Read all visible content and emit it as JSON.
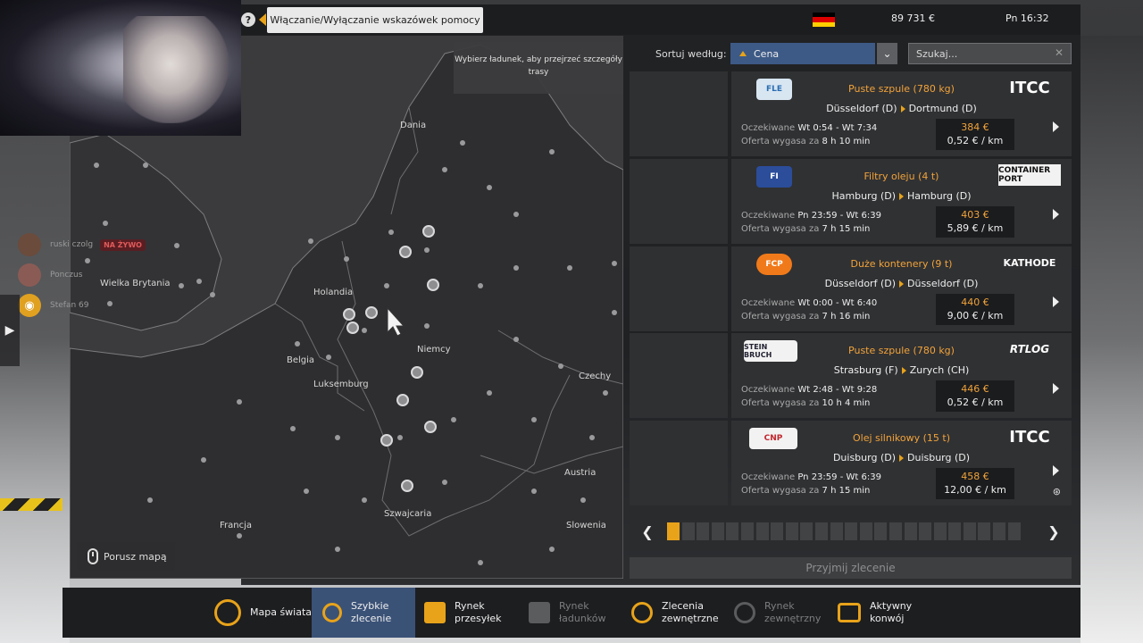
{
  "topbar": {
    "help_icon": "question-icon",
    "tooltip": "Włączanie/Wyłączanie wskazówek pomocy",
    "money": "89 731 €",
    "clock": "Pn 16:32"
  },
  "chat": [
    {
      "name": "ruski czolg",
      "badge": "NA ŻYWO"
    },
    {
      "name": "Ponczus",
      "badge": ""
    },
    {
      "name": "Stefan 69",
      "badge": ""
    }
  ],
  "map": {
    "info": "Wybierz ładunek, aby przejrzeć szczegóły trasy",
    "hint": "Porusz mapą",
    "labels": {
      "dania": "Dania",
      "wielka_brytania": "Wielka Brytania",
      "holandia": "Holandia",
      "niemcy": "Niemcy",
      "belgia": "Belgia",
      "luksemburg": "Luksemburg",
      "czechy": "Czechy",
      "austria": "Austria",
      "francja": "Francja",
      "szwajcaria": "Szwajcaria",
      "slowenia": "Slowenia"
    }
  },
  "sort": {
    "label": "Sortuj według:",
    "selected": "Cena",
    "search_placeholder": "Szukaj..."
  },
  "jobs": [
    {
      "logo": "FLE",
      "company": "ITCC",
      "cargo": "Puste szpule (780 kg)",
      "from": "Düsseldorf (D)",
      "to": "Dortmund (D)",
      "exp_label": "Oczekiwane",
      "expected": "Wt 0:54 - Wt 7:34",
      "off_label": "Oferta wygasa za",
      "expires": "8 h 10 min",
      "price": "384 €",
      "rate": "0,52 € / km"
    },
    {
      "logo": "FI",
      "company": "CONTAINER PORT",
      "cargo": "Filtry oleju (4 t)",
      "from": "Hamburg (D)",
      "to": "Hamburg (D)",
      "exp_label": "Oczekiwane",
      "expected": "Pn 23:59 - Wt 6:39",
      "off_label": "Oferta wygasa za",
      "expires": "7 h 15 min",
      "price": "403 €",
      "rate": "5,89 € / km"
    },
    {
      "logo": "FCP",
      "company": "KATHODE",
      "cargo": "Duże kontenery (9 t)",
      "from": "Düsseldorf (D)",
      "to": "Düsseldorf (D)",
      "exp_label": "Oczekiwane",
      "expected": "Wt 0:00 - Wt 6:40",
      "off_label": "Oferta wygasa za",
      "expires": "7 h 16 min",
      "price": "440 €",
      "rate": "9,00 € / km"
    },
    {
      "logo": "STEIN BRUCH",
      "company": "RTLOG",
      "cargo": "Puste szpule (780 kg)",
      "from": "Strasburg (F)",
      "to": "Zurych (CH)",
      "exp_label": "Oczekiwane",
      "expected": "Wt 2:48 - Wt 9:28",
      "off_label": "Oferta wygasa za",
      "expires": "10 h 4 min",
      "price": "446 €",
      "rate": "0,52 € / km"
    },
    {
      "logo": "CNP",
      "company": "ITCC",
      "cargo": "Olej silnikowy (15 t)",
      "from": "Duisburg (D)",
      "to": "Duisburg (D)",
      "exp_label": "Oczekiwane",
      "expected": "Pn 23:59 - Wt 6:39",
      "off_label": "Oferta wygasa za",
      "expires": "7 h 15 min",
      "price": "458 €",
      "rate": "12,00 € / km"
    }
  ],
  "accept_label": "Przyjmij zlecenie",
  "nav": [
    {
      "label1": "Mapa świata",
      "label2": "",
      "icon": "globe-map-icon"
    },
    {
      "label1": "Szybkie",
      "label2": "zlecenie",
      "icon": "clock-icon"
    },
    {
      "label1": "Rynek",
      "label2": "przesyłek",
      "icon": "boxes-icon"
    },
    {
      "label1": "Rynek",
      "label2": "ładunków",
      "icon": "cargo-icon"
    },
    {
      "label1": "Zlecenia",
      "label2": "zewnętrzne",
      "icon": "network-globe-icon"
    },
    {
      "label1": "Rynek",
      "label2": "zewnętrzny",
      "icon": "external-globe-icon"
    },
    {
      "label1": "Aktywny",
      "label2": "konwój",
      "icon": "convoy-icon"
    }
  ]
}
